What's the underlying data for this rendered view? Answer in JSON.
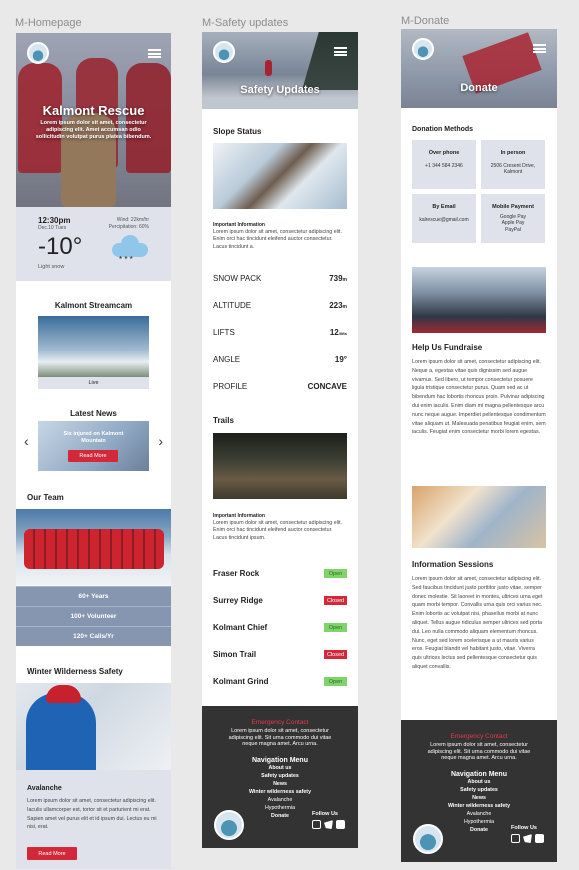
{
  "frames": {
    "homepage_label": "M-Homepage",
    "safety_label": "M-Safety updates",
    "donate_label": "M-Donate"
  },
  "colors": {
    "accent_red": "#d2283a",
    "footer_bg": "#333333",
    "panel_blue": "#dfe2ea",
    "team_blue": "#8796b0",
    "open_green": "#7ed36b"
  },
  "home": {
    "hero_title": "Kalmont Rescue",
    "hero_text": "Lorem ipsum dolor sit amet, consectetur adipiscing elit. Amet accumsan odio sollicitudin volutpat purus platea bibendum.",
    "weather": {
      "time": "12:30pm",
      "date": "Dec.10 Tues",
      "wind": "Wind: 22km/hr",
      "precip": "Percipitation: 60%",
      "temp": "-10°",
      "condition": "Light snow",
      "icon": "snow-cloud-icon"
    },
    "streamcam_title": "Kalmont Streamcam",
    "live_label": "Live",
    "news_title": "Latest News",
    "news_caption": "Six injured on Kalmont Mountain",
    "read_more": "Read More",
    "team_title": "Our Team",
    "team_stats": [
      "60+ Years",
      "100+ Volunteer",
      "120+ Calls/Yr"
    ],
    "wws_title": "Winter Wilderness Safety",
    "avalanche_title": "Avalanche",
    "avalanche_text": "Lorem ipsum dolor sit amet, consectetur adipiscing elit. Iaculis ullamcorper est, tortor sit et parturient mi erat. Sapien amet vel purus elit et id ipsum dui. Lectus eu mi nisi, erat.",
    "avalanche_button": "Read More"
  },
  "safety": {
    "hero_title": "Safety Updates",
    "slope_title": "Slope Status",
    "important_label": "Important Information",
    "important_text": "Lorem ipsum dolor sit amet, consectetur adipiscing elit. Enim orci hac tincidunt eleifend auctor consectetur. Lacus tincidunt a.",
    "stats": [
      {
        "label": "SNOW PACK",
        "value": "739",
        "unit": "m"
      },
      {
        "label": "ALTITUDE",
        "value": "223",
        "unit": "m"
      },
      {
        "label": "LIFTS",
        "value": "12",
        "unit": "/lifts"
      },
      {
        "label": "ANGLE",
        "value": "19°",
        "unit": ""
      },
      {
        "label": "PROFILE",
        "value": "CONCAVE",
        "unit": ""
      }
    ],
    "trails_title": "Trails",
    "trails_important_label": "Important Information",
    "trails_important_text": "Lorem ipsum dolor sit amet, consectetur adipiscing elit. Enim orci hac tincidunt eleifend auctor consectetur. Lacus tincidunt ipsum.",
    "trails": [
      {
        "name": "Fraser Rock",
        "status": "Open"
      },
      {
        "name": "Surrey Ridge",
        "status": "Closed"
      },
      {
        "name": "Kolmant Chief",
        "status": "Open"
      },
      {
        "name": "Simon Trail",
        "status": "Closed"
      },
      {
        "name": "Kolmant Grind",
        "status": "Open"
      }
    ]
  },
  "donate": {
    "hero_title": "Donate",
    "methods_title": "Donation Methods",
    "methods": [
      {
        "head": "Over phone",
        "text": "+1 344 584 2346"
      },
      {
        "head": "In person",
        "text": "2506 Cresent Drive, Kalmont"
      },
      {
        "head": "By Email",
        "text": "kalrescue@gmail.com"
      },
      {
        "head": "Mobile Payment",
        "text": "Google Pay\nApple Pay\nPayPal"
      }
    ],
    "fundraise_title": "Help Us Fundraise",
    "fundraise_text": "Lorem ipsum dolor sit amet, consectetur adipiscing elit. Neque a, egestas vitae quis dignissim sed augue vivamus. Sed libero, ut tempor consectetur posuere ligula tristique consectetur purus. Quam sed ac ut bibendum hac lobortis rhoncus proin. Pulvinar adipiscing dui enim iaculis. Enim diam mi magna pellentesque arcu nunc neque augue. Imperdiet pellentesque condimentum vitae aliquam ut. Malesuada penatibus feugiat enim, sem iaculis. Feugiat enim consectetur morbi lorem egestas.",
    "sessions_title": "Information Sessions",
    "sessions_text": "Lorem ipsum dolor sit amet, consectetur adipiscing elit. Sed faucibus tincidunt justo porttitor justo vitae, semper donec molestie. Sit laoreet in montes, ultrices urna eget quam morbi tempor. Convallis urna quis orci varius nec. Enim lobortis ac volutpat nisi, phasellus morbi at nunc aliquet. Tellus augue ridiculus semper ultrices sed porta dui. Leo nulla commodo aliquam elementum rhoncus. Nunc, eget sed lorem scelerisque a ut mauris varius eros. Feugiat blandit vel habitant justo, vitae. Viverra quis ultrices lectus sed pellentesque consectetur quis aliquet convallis."
  },
  "footer": {
    "emergency_title": "Emergency Contact",
    "emergency_text": "Lorem ipsum dolor sit amet, consectetur adipiscing elit. Sit urna commodo dui vitae neque magna amet. Arcu urna.",
    "nav_title": "Navigation Menu",
    "nav_items": [
      "About us",
      "Safety updates",
      "News",
      "Winter wilderness safety",
      "Avalanche",
      "Hypothermia",
      "Donate"
    ],
    "follow": "Follow Us"
  }
}
